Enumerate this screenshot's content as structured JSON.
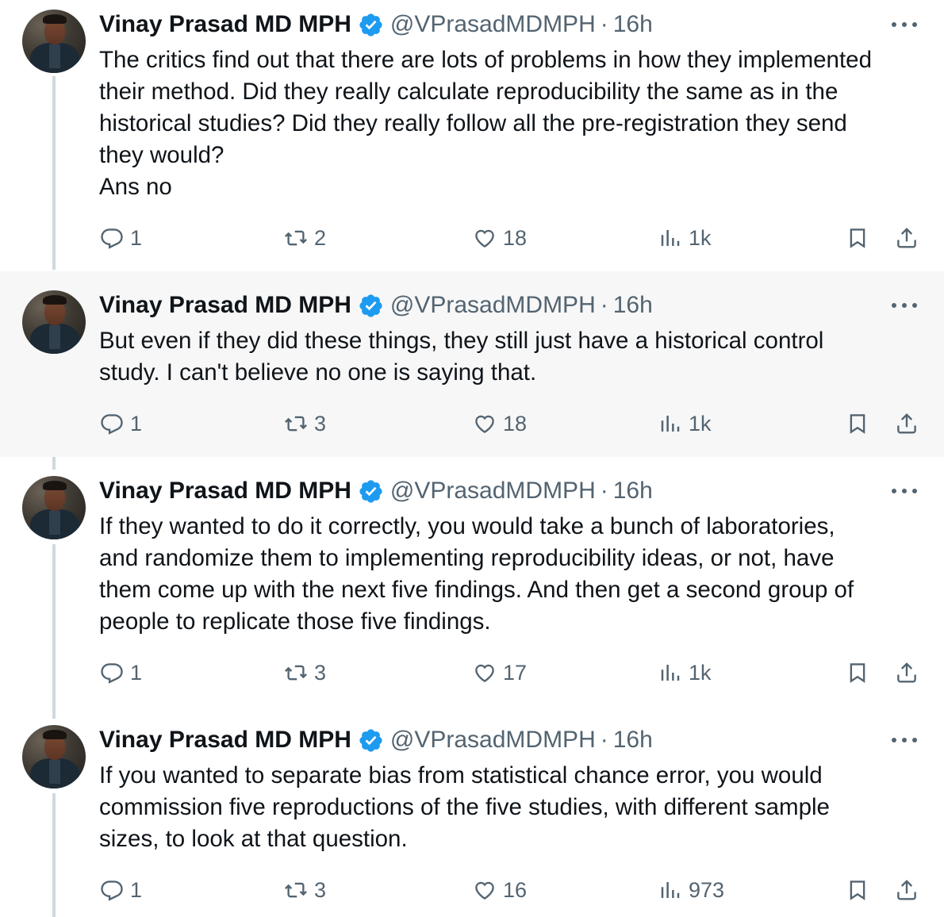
{
  "author": {
    "name": "Vinay Prasad MD MPH",
    "handle": "@VPrasadMDMPH",
    "separator": "·"
  },
  "colors": {
    "verified": "#1d9bf0",
    "muted": "#536471",
    "thread_line": "#cfd9de",
    "highlight_bg": "#f7f7f7"
  },
  "tweets": [
    {
      "time": "16h",
      "lines": [
        "The critics find out that there are lots of problems in how they implemented",
        "their method. Did they really calculate reproducibility the same as in the",
        "historical studies? Did they really follow all the pre-registration they send",
        "they would?",
        "Ans no"
      ],
      "replies": "1",
      "retweets": "2",
      "likes": "18",
      "views": "1k"
    },
    {
      "time": "16h",
      "lines": [
        "But even if they did these things, they still just have a historical control",
        "study.  I can't believe no one is saying that."
      ],
      "replies": "1",
      "retweets": "3",
      "likes": "18",
      "views": "1k"
    },
    {
      "time": "16h",
      "lines": [
        "If they wanted to do it correctly, you would take a bunch of laboratories,",
        "and randomize them to implementing reproducibility ideas, or not, have",
        "them come up with the next five findings. And then get a second group of",
        "people to replicate those five findings."
      ],
      "replies": "1",
      "retweets": "3",
      "likes": "17",
      "views": "1k"
    },
    {
      "time": "16h",
      "lines": [
        "If you wanted to separate bias from statistical chance error, you would",
        "commission five reproductions of the five studies, with different sample",
        "sizes, to look at that question."
      ],
      "replies": "1",
      "retweets": "3",
      "likes": "16",
      "views": "973"
    }
  ],
  "icons": {
    "reply": "reply-icon",
    "retweet": "retweet-icon",
    "like": "heart-icon",
    "views": "views-icon",
    "bookmark": "bookmark-icon",
    "share": "share-icon",
    "more": "more-icon",
    "verified": "verified-badge-icon"
  }
}
